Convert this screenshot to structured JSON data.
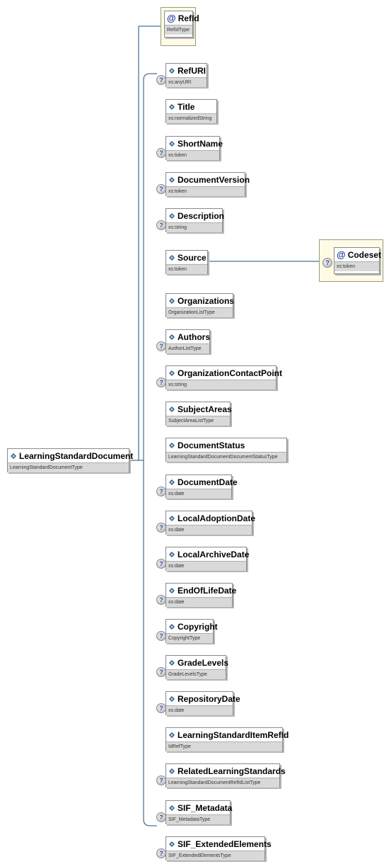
{
  "diagram": {
    "root": {
      "name": "LearningStandardDocument",
      "type": "LearningStandardDocumentType"
    },
    "attributes": [
      {
        "name": "RefId",
        "type": "RefIdType"
      }
    ],
    "children": [
      {
        "name": "RefURI",
        "type": "xs:anyURI",
        "optional": true
      },
      {
        "name": "Title",
        "type": "xs:normalizedString",
        "optional": false
      },
      {
        "name": "ShortName",
        "type": "xs:token",
        "optional": true
      },
      {
        "name": "DocumentVersion",
        "type": "xs:token",
        "optional": true
      },
      {
        "name": "Description",
        "type": "xs:string",
        "optional": true
      },
      {
        "name": "Source",
        "type": "xs:token",
        "optional": false
      },
      {
        "name": "Organizations",
        "type": "OrganizationListType",
        "optional": false
      },
      {
        "name": "Authors",
        "type": "AuthorListType",
        "optional": true
      },
      {
        "name": "OrganizationContactPoint",
        "type": "xs:string",
        "optional": true
      },
      {
        "name": "SubjectAreas",
        "type": "SubjectAreaListType",
        "optional": false
      },
      {
        "name": "DocumentStatus",
        "type": "LearningStandardDocumentDocumentStatusType",
        "optional": false
      },
      {
        "name": "DocumentDate",
        "type": "xs:date",
        "optional": true
      },
      {
        "name": "LocalAdoptionDate",
        "type": "xs:date",
        "optional": true
      },
      {
        "name": "LocalArchiveDate",
        "type": "xs:date",
        "optional": true
      },
      {
        "name": "EndOfLifeDate",
        "type": "xs:date",
        "optional": true
      },
      {
        "name": "Copyright",
        "type": "CopyrightType",
        "optional": true
      },
      {
        "name": "GradeLevels",
        "type": "GradeLevelsType",
        "optional": true
      },
      {
        "name": "RepositoryDate",
        "type": "xs:date",
        "optional": true
      },
      {
        "name": "LearningStandardItemRefId",
        "type": "IdRefType",
        "optional": false
      },
      {
        "name": "RelatedLearningStandards",
        "type": "LearningStandardDocumentRefIdListType",
        "optional": true
      },
      {
        "name": "SIF_Metadata",
        "type": "SIF_MetadataType",
        "optional": true
      },
      {
        "name": "SIF_ExtendedElements",
        "type": "SIF_ExtendedElementsType",
        "optional": true
      }
    ],
    "source_attribute": {
      "name": "Codeset",
      "type": "xs:token",
      "optional": true
    },
    "optional_marker": "?",
    "attribute_marker": "@",
    "colors": {
      "connector": "#1f4e79",
      "attribute_fill": "#fffbe6",
      "type_band": "#d9d9d9",
      "element_icon": "#1f5fbf"
    },
    "icons": {
      "element": "element-icon",
      "attribute": "attribute-icon",
      "optional": "optional-icon"
    }
  }
}
